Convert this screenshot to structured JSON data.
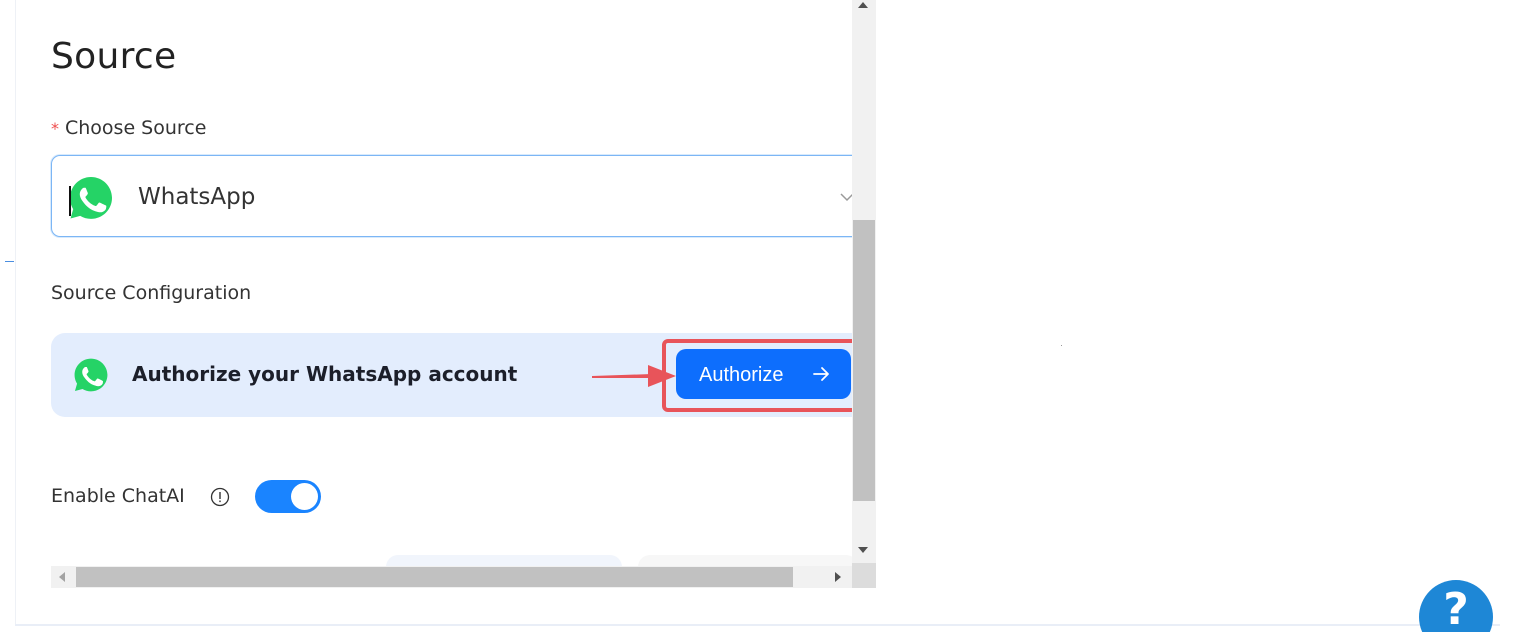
{
  "form": {
    "heading": "Source",
    "choose_source": {
      "required_mark": "*",
      "label": "Choose Source",
      "selected_value": "WhatsApp"
    },
    "source_configuration": {
      "label": "Source Configuration",
      "banner_text": "Authorize your WhatsApp account",
      "authorize_button_label": "Authorize"
    },
    "enable_chatai": {
      "label": "Enable ChatAI",
      "enabled": true
    }
  },
  "help": {
    "label": "?"
  },
  "colors": {
    "whatsapp_green": "#25d366",
    "primary_blue": "#0d6efd",
    "toggle_blue": "#1a84ff",
    "highlight_red": "#e8545a",
    "banner_bg": "#e3edfd",
    "required_red": "#ee4d4d"
  },
  "icons": {
    "source_logo": "whatsapp-icon",
    "dropdown": "chevron-down-icon",
    "button_arrow": "arrow-right-icon",
    "info": "info-icon",
    "help": "help-icon"
  }
}
